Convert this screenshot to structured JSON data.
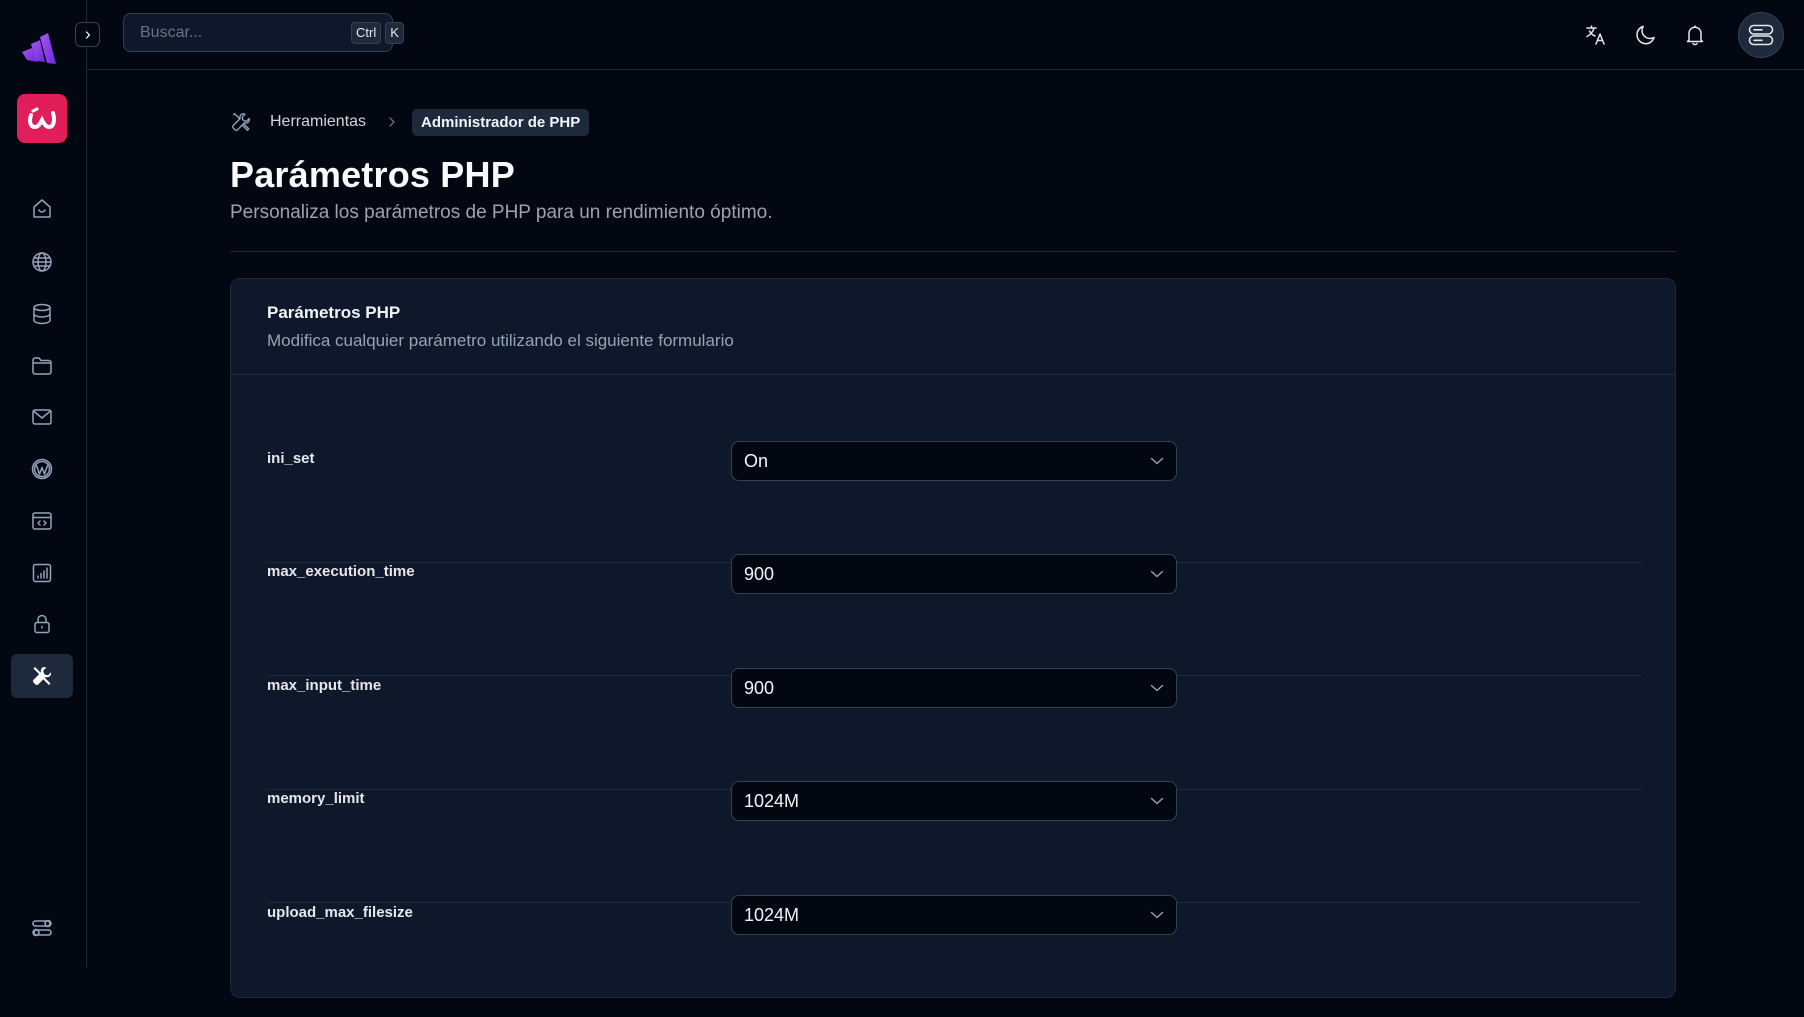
{
  "sidebar": {
    "items": [
      {
        "name": "home",
        "label": "Inicio"
      },
      {
        "name": "globe",
        "label": "Dominios"
      },
      {
        "name": "database",
        "label": "Bases de datos"
      },
      {
        "name": "folder",
        "label": "Archivos"
      },
      {
        "name": "mail",
        "label": "Correo"
      },
      {
        "name": "wordpress",
        "label": "WordPress"
      },
      {
        "name": "code-window",
        "label": "Desarrollo"
      },
      {
        "name": "stats",
        "label": "Estadísticas"
      },
      {
        "name": "lock",
        "label": "Seguridad"
      },
      {
        "name": "tools",
        "label": "Herramientas",
        "active": true
      }
    ],
    "brand_letter": "ω"
  },
  "topbar": {
    "search_placeholder": "Buscar...",
    "shortcut_keys": [
      "Ctrl",
      "K"
    ]
  },
  "breadcrumb": {
    "parent": "Herramientas",
    "current": "Administrador de PHP"
  },
  "page": {
    "title": "Parámetros PHP",
    "subtitle": "Personaliza los parámetros de PHP para un rendimiento óptimo."
  },
  "card": {
    "title": "Parámetros PHP",
    "description": "Modifica cualquier parámetro utilizando el siguiente formulario",
    "params": [
      {
        "key": "ini_set",
        "value": "On"
      },
      {
        "key": "max_execution_time",
        "value": "900"
      },
      {
        "key": "max_input_time",
        "value": "900"
      },
      {
        "key": "memory_limit",
        "value": "1024M"
      },
      {
        "key": "upload_max_filesize",
        "value": "1024M"
      }
    ]
  },
  "colors": {
    "accent": "#e11d5a",
    "logo": "#8b5cf6",
    "background": "#030712",
    "card": "#0f172a"
  }
}
